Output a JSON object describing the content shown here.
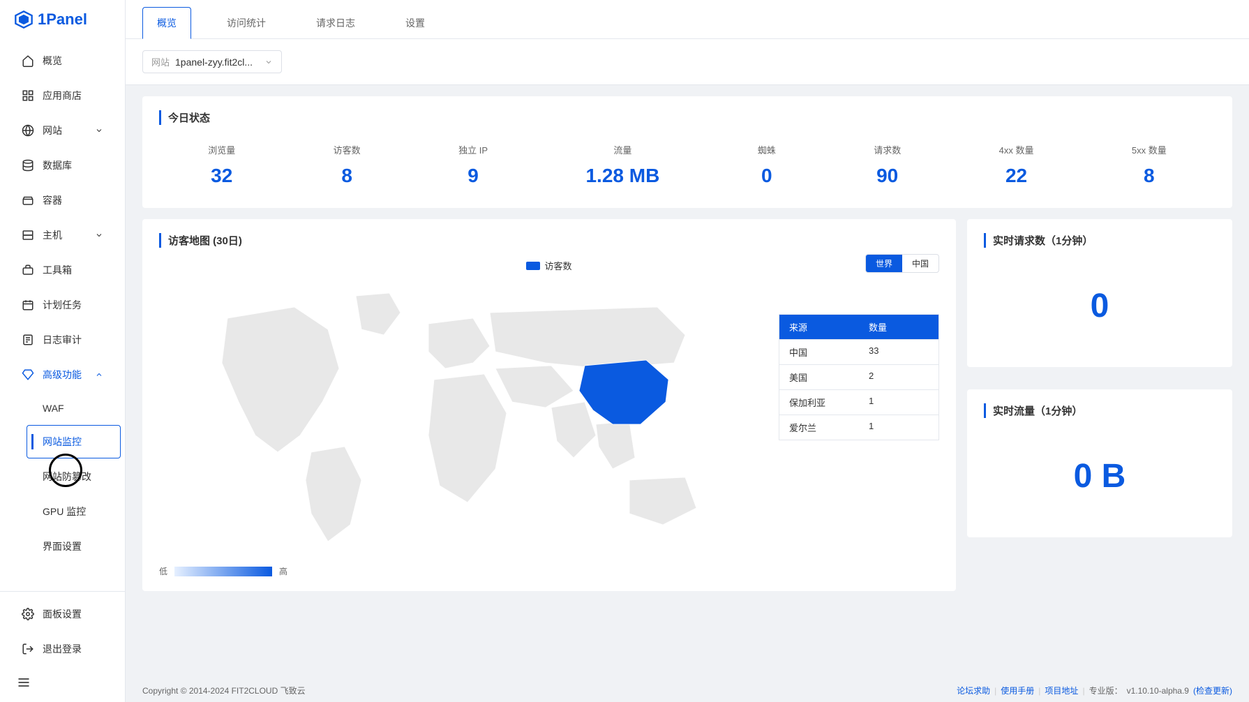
{
  "brand": "1Panel",
  "sidebar": {
    "items": [
      {
        "label": "概览",
        "icon": "home"
      },
      {
        "label": "应用商店",
        "icon": "grid"
      },
      {
        "label": "网站",
        "icon": "globe",
        "expandable": true
      },
      {
        "label": "数据库",
        "icon": "db"
      },
      {
        "label": "容器",
        "icon": "container"
      },
      {
        "label": "主机",
        "icon": "server",
        "expandable": true
      },
      {
        "label": "工具箱",
        "icon": "toolbox"
      },
      {
        "label": "计划任务",
        "icon": "calendar"
      },
      {
        "label": "日志审计",
        "icon": "log"
      },
      {
        "label": "高级功能",
        "icon": "diamond",
        "expandable": true,
        "expanded": true
      }
    ],
    "advanced_sub": [
      {
        "label": "WAF"
      },
      {
        "label": "网站监控",
        "active": true
      },
      {
        "label": "网站防篡改"
      },
      {
        "label": "GPU 监控"
      },
      {
        "label": "界面设置"
      }
    ],
    "footer": [
      {
        "label": "面板设置",
        "icon": "gear"
      },
      {
        "label": "退出登录",
        "icon": "logout"
      }
    ]
  },
  "tabs": [
    {
      "label": "概览",
      "active": true
    },
    {
      "label": "访问统计"
    },
    {
      "label": "请求日志"
    },
    {
      "label": "设置"
    }
  ],
  "site_select": {
    "label": "网站",
    "value": "1panel-zyy.fit2cl..."
  },
  "today": {
    "title": "今日状态",
    "stats": [
      {
        "label": "浏览量",
        "value": "32"
      },
      {
        "label": "访客数",
        "value": "8"
      },
      {
        "label": "独立 IP",
        "value": "9"
      },
      {
        "label": "流量",
        "value": "1.28 MB"
      },
      {
        "label": "蜘蛛",
        "value": "0"
      },
      {
        "label": "请求数",
        "value": "90"
      },
      {
        "label": "4xx 数量",
        "value": "22"
      },
      {
        "label": "5xx 数量",
        "value": "8"
      }
    ]
  },
  "map": {
    "title": "访客地图 (30日)",
    "legend_label": "访客数",
    "toggle": {
      "world": "世界",
      "china": "中国"
    },
    "table_head": {
      "source": "来源",
      "count": "数量"
    },
    "rows": [
      {
        "source": "中国",
        "count": "33"
      },
      {
        "source": "美国",
        "count": "2"
      },
      {
        "source": "保加利亚",
        "count": "1"
      },
      {
        "source": "爱尔兰",
        "count": "1"
      }
    ],
    "gradient": {
      "low": "低",
      "high": "高"
    }
  },
  "realtime_requests": {
    "title": "实时请求数（1分钟）",
    "value": "0"
  },
  "realtime_traffic": {
    "title": "实时流量（1分钟）",
    "value": "0 B"
  },
  "footer": {
    "copyright": "Copyright © 2014-2024 FIT2CLOUD 飞致云",
    "links": [
      {
        "label": "论坛求助"
      },
      {
        "label": "使用手册"
      },
      {
        "label": "项目地址"
      }
    ],
    "version_label": "专业版：",
    "version": "v1.10.10-alpha.9",
    "check_update": "检查更新"
  },
  "chart_data": {
    "type": "map",
    "title": "访客地图 (30日)",
    "metric": "访客数",
    "scope": "世界",
    "data": [
      {
        "region": "中国",
        "value": 33
      },
      {
        "region": "美国",
        "value": 2
      },
      {
        "region": "保加利亚",
        "value": 1
      },
      {
        "region": "爱尔兰",
        "value": 1
      }
    ]
  }
}
